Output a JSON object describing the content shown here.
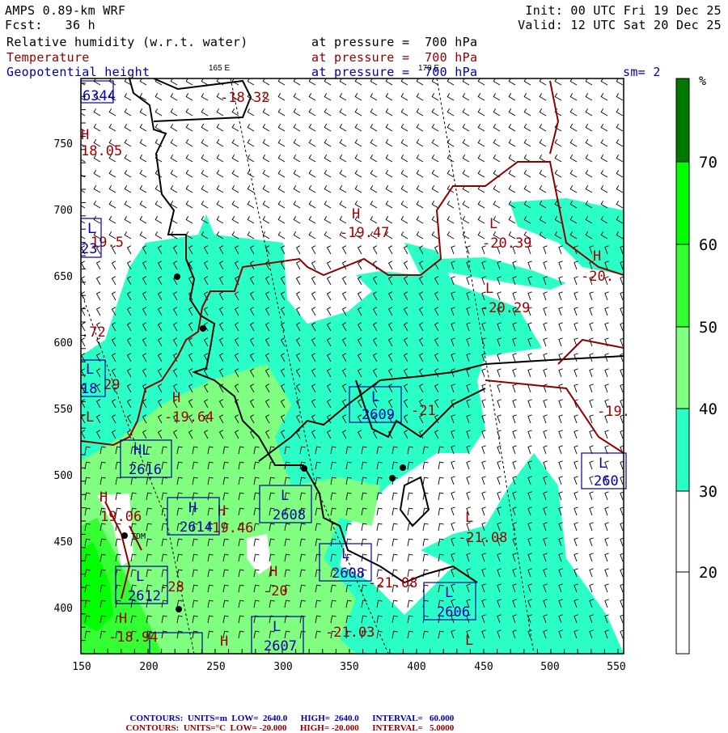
{
  "header": {
    "model": "AMPS 0.89-km WRF",
    "forecast": "Fcst:   36 h",
    "init": "Init: 00 UTC Fri 19 Dec 25",
    "valid": "Valid: 12 UTC Sat 20 Dec 25",
    "fields": [
      {
        "name": "Relative humidity (w.r.t. water)",
        "level": "at pressure =  700 hPa"
      },
      {
        "name": "Temperature",
        "level": "at pressure =  700 hPa"
      },
      {
        "name": "Geopotential height",
        "level": "at pressure =  700 hPa"
      }
    ],
    "smoothing": "sm= 2",
    "lon_labels": [
      "165 E",
      "170 E"
    ]
  },
  "axes": {
    "x_ticks": [
      "150",
      "200",
      "250",
      "300",
      "350",
      "400",
      "450",
      "500",
      "550"
    ],
    "y_ticks": [
      "750",
      "700",
      "650",
      "600",
      "550",
      "500",
      "450",
      "400"
    ]
  },
  "colorbar": {
    "unit": "%",
    "labels": [
      "70",
      "60",
      "50",
      "40",
      "30",
      "20"
    ],
    "colors": [
      "#007800",
      "#00ff00",
      "#33ff33",
      "#80ff80",
      "#2affc8",
      "#ffffff",
      "#ffffff"
    ]
  },
  "map_labels": {
    "temperature": [
      "-18.32",
      "H",
      "18.05",
      "19.5",
      "H",
      "-19.47",
      "L",
      "-20.39",
      "H",
      "-20.",
      "L",
      "-20.29",
      ".72",
      "29",
      "H",
      "-19.64",
      "H",
      "19.06",
      "-19.46",
      "H",
      "-20",
      "L",
      "-21.08",
      "-21.08",
      "-18.94",
      "H",
      "-21.03",
      "L",
      "-19.",
      "-28",
      "-21",
      "H",
      "H",
      "L"
    ],
    "height": [
      "6344",
      "L",
      "23",
      "L",
      "18",
      "HL",
      "2616",
      "H",
      "2614",
      "L",
      "2608",
      "L",
      "2609",
      "L",
      "2608",
      "L",
      "2606",
      "L",
      "2607",
      "L",
      "2612",
      "L",
      "260"
    ],
    "station": "TDM"
  },
  "footer": {
    "height_contours": {
      "label": "CONTOURS:",
      "units": "UNITS=m",
      "low": "LOW=  2640.0",
      "high": "HIGH=  2640.0",
      "interval": "INTERVAL=   60.000"
    },
    "temp_contours": {
      "label": "CONTOURS:",
      "units": "UNITS=°C",
      "low": "LOW= -20.000",
      "high": "HIGH= -20.000",
      "interval": "INTERVAL=   5.0000"
    }
  }
}
